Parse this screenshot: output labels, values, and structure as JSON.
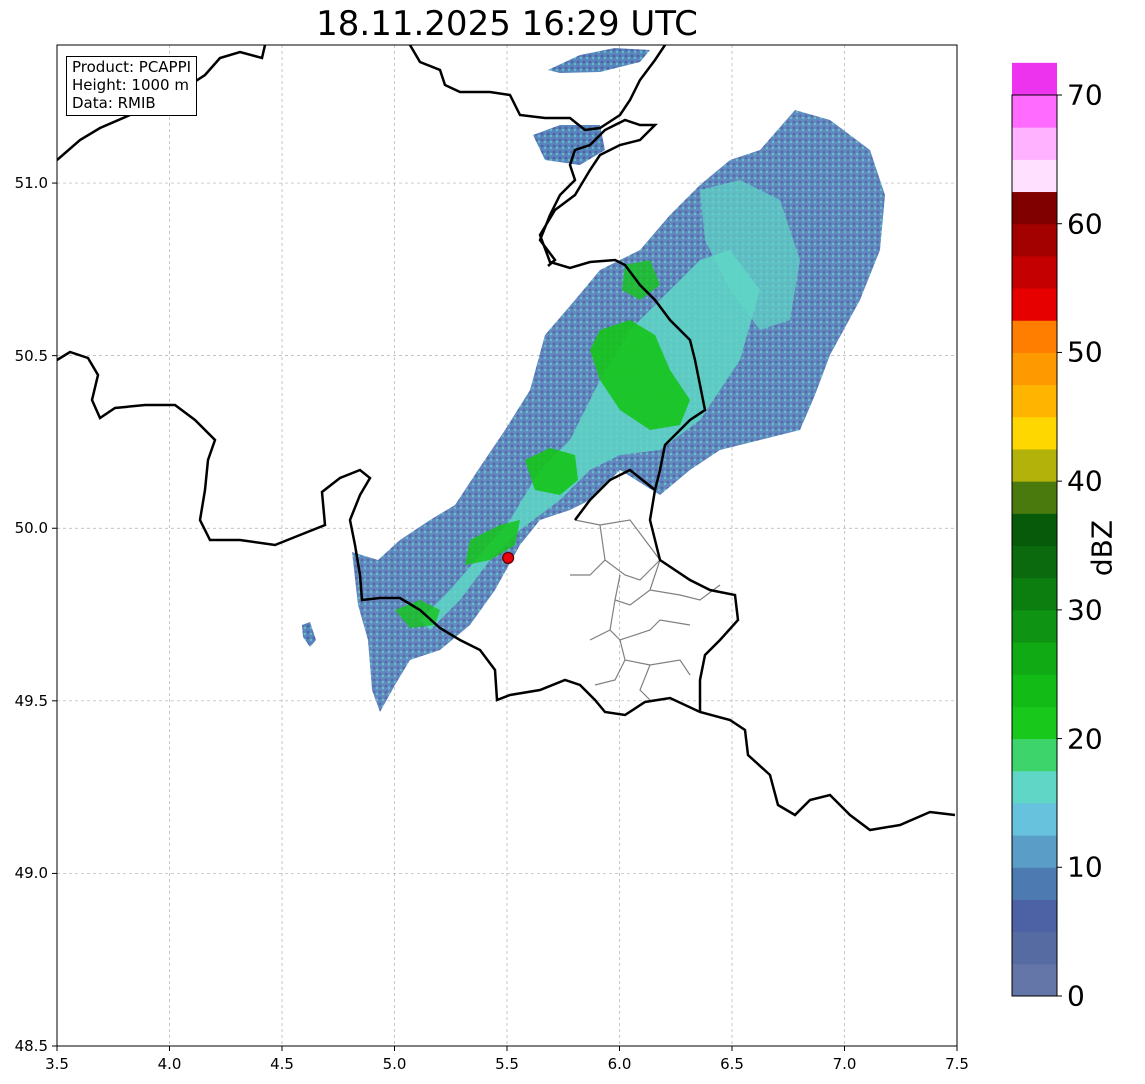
{
  "title": "18.11.2025 16:29 UTC",
  "infobox": {
    "product": "Product: PCAPPI",
    "height": "Height: 1000 m",
    "data": "Data: RMIB"
  },
  "axes": {
    "x_ticks": [
      "3.5",
      "4.0",
      "4.5",
      "5.0",
      "5.5",
      "6.0",
      "6.5",
      "7.0",
      "7.5"
    ],
    "y_ticks": [
      "51.0",
      "50.5",
      "50.0",
      "49.5",
      "49.0",
      "48.5"
    ],
    "xlim": [
      3.5,
      7.5
    ],
    "ylim": [
      48.5,
      51.4
    ],
    "grid": true
  },
  "colorbar": {
    "label": "dBZ",
    "min": 0,
    "max": 70,
    "step": 2.5,
    "tick_labels": [
      "0",
      "10",
      "20",
      "30",
      "40",
      "50",
      "60",
      "70"
    ],
    "colors": [
      "#6475a8",
      "#566ba1",
      "#4d62a4",
      "#4d7ab0",
      "#5a9ec8",
      "#66c2dd",
      "#5fd6c6",
      "#3dd46c",
      "#18c81a",
      "#12bb16",
      "#0faa14",
      "#0e9312",
      "#0c7e10",
      "#0a6a0d",
      "#085a0b",
      "#4a7a0d",
      "#b2b20a",
      "#ffd700",
      "#ffb500",
      "#ff9900",
      "#ff7e00",
      "#e60000",
      "#c40000",
      "#a30000",
      "#800000",
      "#ffe1ff",
      "#ffb2ff",
      "#ff6bff",
      "#ee33ee"
    ]
  },
  "radar_site": {
    "lon": 5.505,
    "lat": 49.914,
    "color": "#e8000b"
  },
  "echo_colors": {
    "weak": "#4d7ab0",
    "medium": "#5fd6c6",
    "strong": "#15c41a"
  }
}
